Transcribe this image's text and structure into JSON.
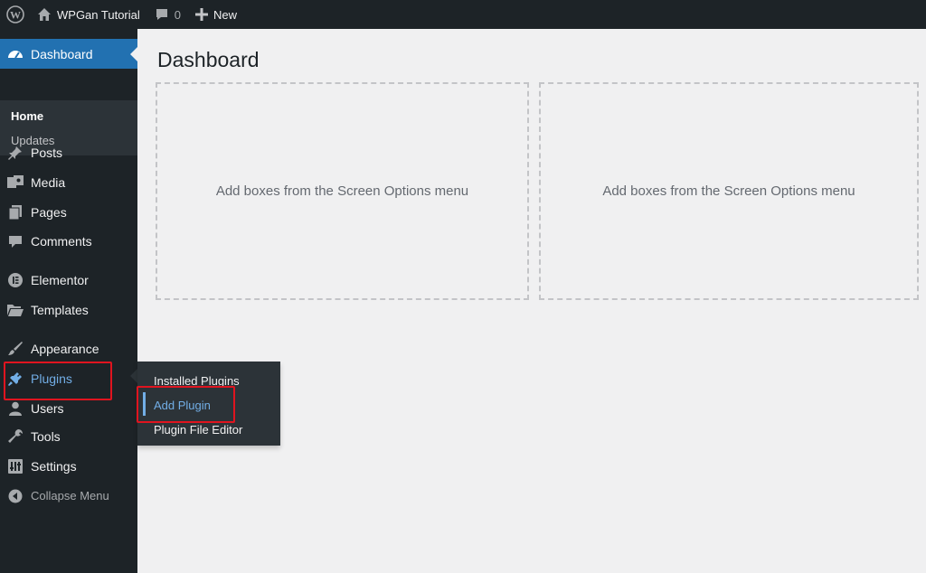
{
  "adminbar": {
    "site_name": "WPGan Tutorial",
    "comments_count": "0",
    "new_label": "New"
  },
  "sidebar": {
    "dashboard": "Dashboard",
    "submenu": {
      "home": "Home",
      "updates": "Updates"
    },
    "items": {
      "posts": "Posts",
      "media": "Media",
      "pages": "Pages",
      "comments": "Comments",
      "elementor": "Elementor",
      "templates": "Templates",
      "appearance": "Appearance",
      "plugins": "Plugins",
      "users": "Users",
      "tools": "Tools",
      "settings": "Settings"
    },
    "collapse": "Collapse Menu"
  },
  "plugins_flyout": {
    "items": [
      "Installed Plugins",
      "Add Plugin",
      "Plugin File Editor"
    ],
    "active_index": 1
  },
  "main": {
    "title": "Dashboard",
    "boxes": [
      "Add boxes from the Screen Options menu",
      "Add boxes from the Screen Options menu"
    ]
  },
  "colors": {
    "adminbar_bg": "#1d2327",
    "menu_highlight": "#2271b1",
    "active_link": "#72aee6",
    "annotation_outline": "#e0141f"
  }
}
